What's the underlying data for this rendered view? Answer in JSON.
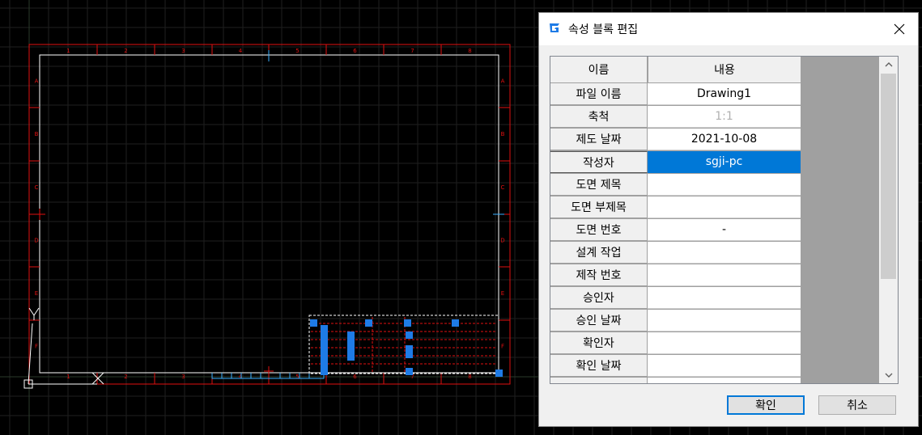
{
  "dialog": {
    "title": "속성 블록 편집",
    "header": {
      "name": "이름",
      "value": "내용"
    },
    "rows": [
      {
        "name": "파일 이름",
        "value": "Drawing1"
      },
      {
        "name": "축척",
        "value": "1:1"
      },
      {
        "name": "제도 날짜",
        "value": "2021-10-08"
      },
      {
        "name": "작성자",
        "value": "sgji-pc"
      },
      {
        "name": "도면 제목",
        "value": ""
      },
      {
        "name": "도면 부제목",
        "value": ""
      },
      {
        "name": "도면 번호",
        "value": "-"
      },
      {
        "name": "설계 작업",
        "value": ""
      },
      {
        "name": "제작 번호",
        "value": ""
      },
      {
        "name": "승인자",
        "value": ""
      },
      {
        "name": "승인 날짜",
        "value": ""
      },
      {
        "name": "확인자",
        "value": ""
      },
      {
        "name": "확인 날짜",
        "value": ""
      }
    ],
    "ok_label": "확인",
    "cancel_label": "취소"
  },
  "cad": {
    "top_numbers": [
      "1",
      "2",
      "3",
      "4",
      "5",
      "6",
      "7",
      "8"
    ],
    "bottom_numbers": [
      "1",
      "2",
      "3",
      "4",
      "5",
      "6",
      "7",
      "8"
    ],
    "side_letters": [
      "A",
      "B",
      "C",
      "D",
      "E",
      "F"
    ]
  },
  "colors": {
    "accent": "#0078d7",
    "cad_border": "#e01010",
    "cad_frame": "#ffffff",
    "grip": "#1e7be6"
  },
  "icons": {
    "app": "gstarcad-logo-icon",
    "close": "close-icon",
    "scroll_up": "chevron-up-icon",
    "scroll_down": "chevron-down-icon"
  }
}
